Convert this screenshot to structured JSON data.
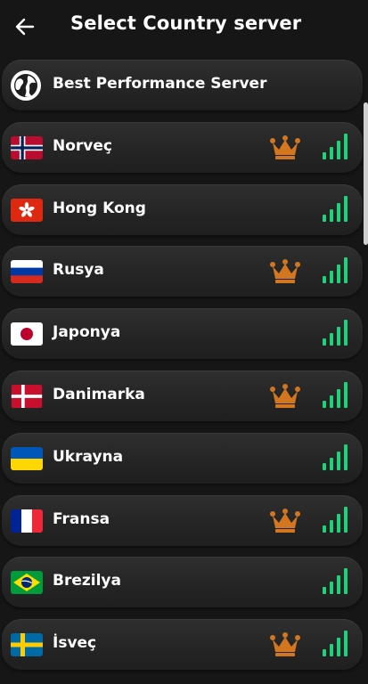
{
  "header": {
    "title": "Select Country server"
  },
  "best": {
    "label": "Best Performance Server"
  },
  "servers": [
    {
      "name": "Norveç",
      "flag": "norway-flag",
      "premium": true
    },
    {
      "name": "Hong Kong",
      "flag": "hong-kong-flag",
      "premium": false
    },
    {
      "name": "Rusya",
      "flag": "russia-flag",
      "premium": true
    },
    {
      "name": "Japonya",
      "flag": "japan-flag",
      "premium": false
    },
    {
      "name": "Danimarka",
      "flag": "denmark-flag",
      "premium": true
    },
    {
      "name": "Ukrayna",
      "flag": "ukraine-flag",
      "premium": false
    },
    {
      "name": "Fransa",
      "flag": "france-flag",
      "premium": true
    },
    {
      "name": "Brezilya",
      "flag": "brazil-flag",
      "premium": false
    },
    {
      "name": "İsveç",
      "flag": "sweden-flag",
      "premium": true
    }
  ],
  "colors": {
    "signal": "#1fd17a",
    "crown": "#d2771f",
    "background": "#161616"
  }
}
